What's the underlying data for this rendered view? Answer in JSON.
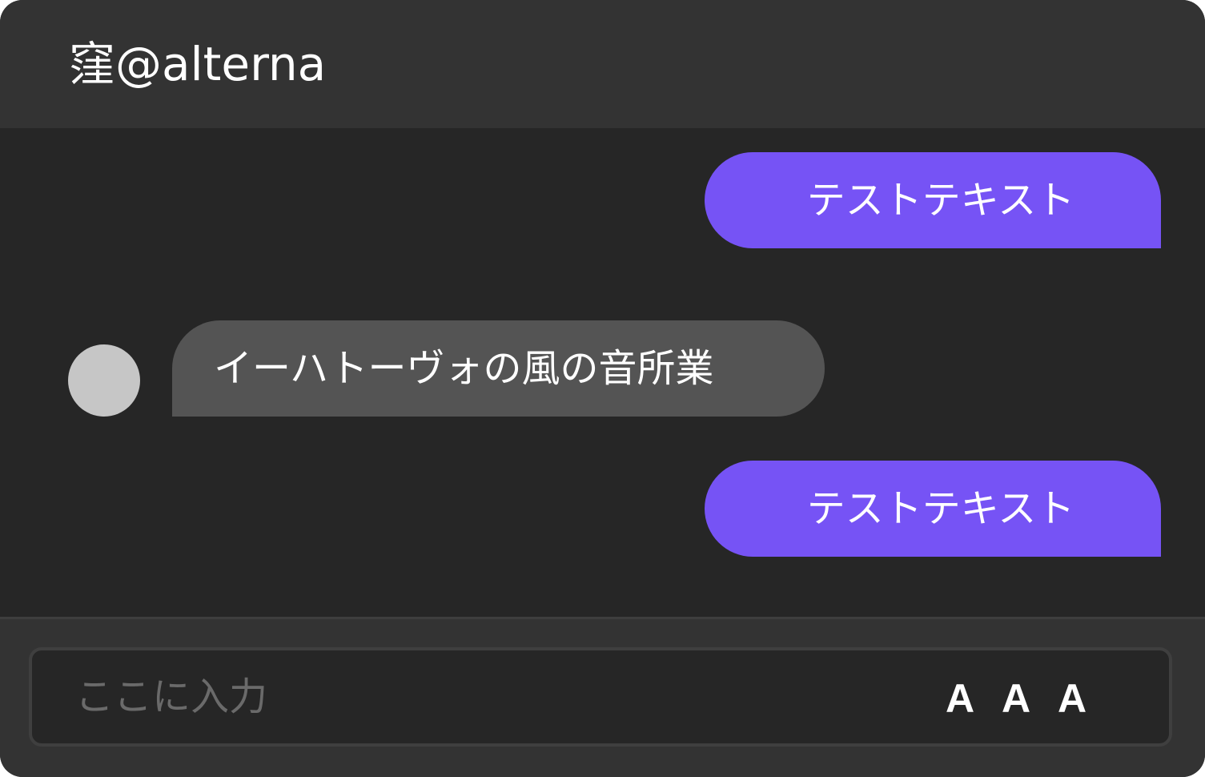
{
  "header": {
    "title": "窪@alterna"
  },
  "messages": [
    {
      "direction": "sent",
      "text": "テストテキスト"
    },
    {
      "direction": "received",
      "text": "イーハトーヴォの風の音所業"
    },
    {
      "direction": "sent",
      "text": "テストテキスト"
    }
  ],
  "composer": {
    "placeholder": "ここに入力",
    "font_buttons": [
      "A",
      "A",
      "A"
    ]
  },
  "colors": {
    "window_bg": "#262626",
    "header_bg": "#333333",
    "sent_bubble": "#7653f5",
    "received_bubble": "#545454",
    "avatar": "#c6c6c6",
    "placeholder_text": "#6a6a6a"
  }
}
